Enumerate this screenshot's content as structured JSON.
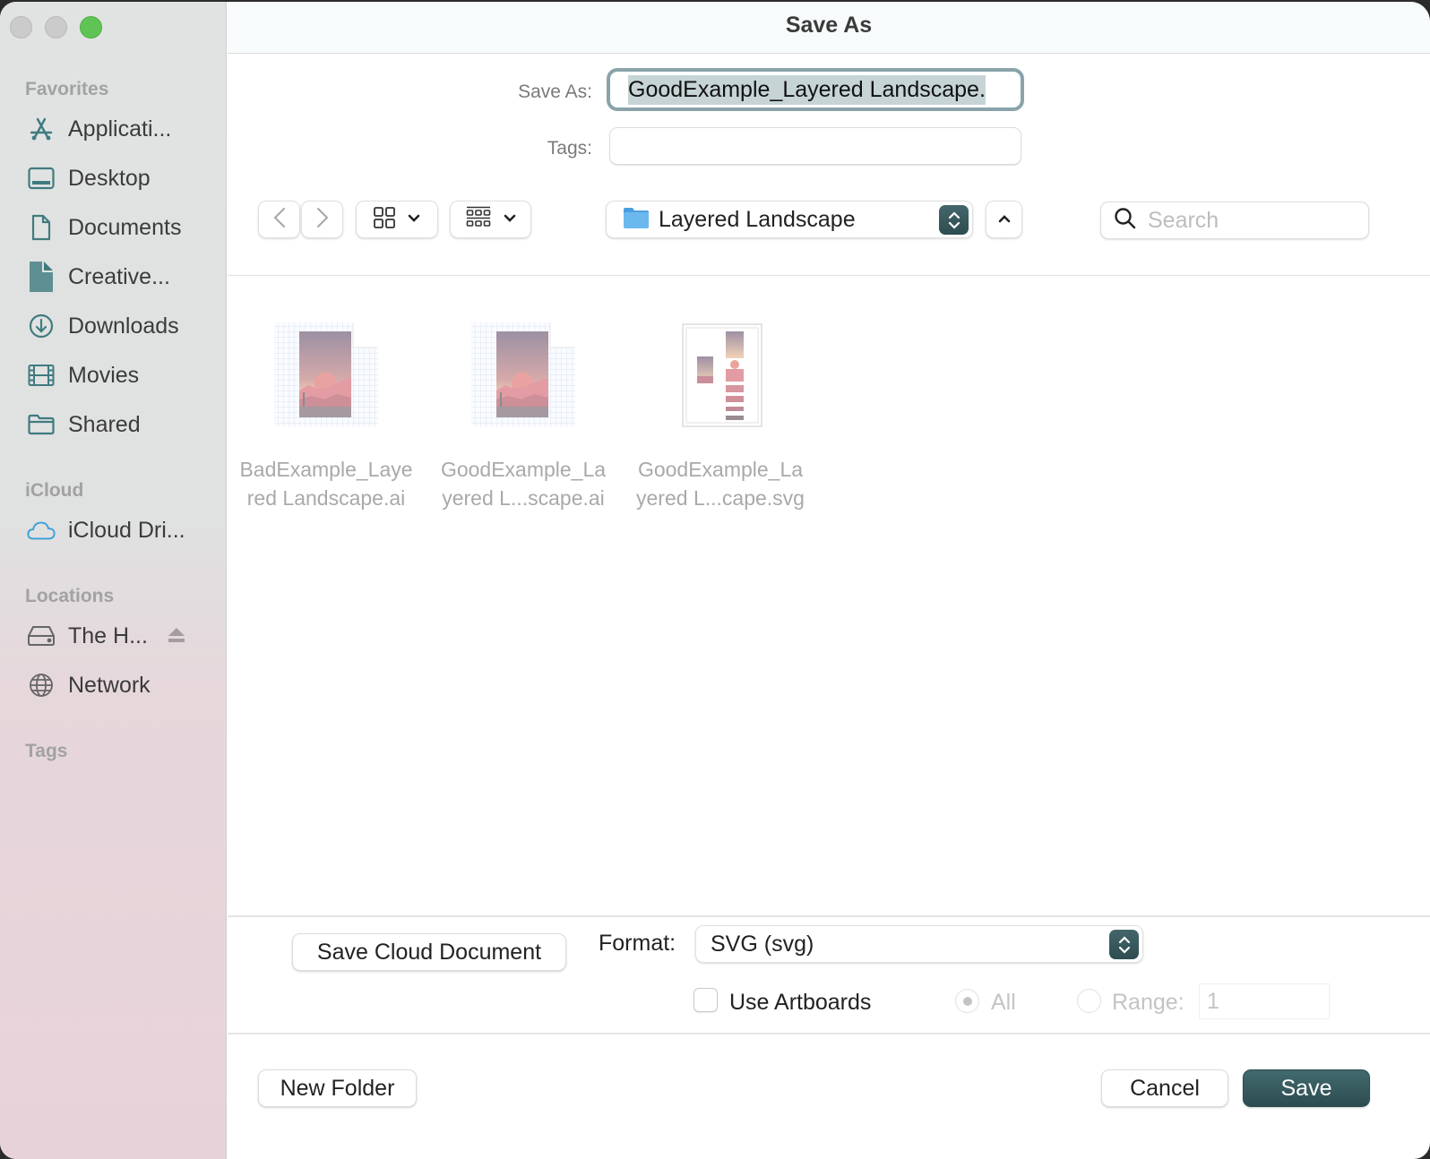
{
  "window": {
    "title": "Save As"
  },
  "sidebar": {
    "sections": [
      {
        "label": "Favorites",
        "items": [
          {
            "label": "Applicati...",
            "icon": "applications-icon"
          },
          {
            "label": "Desktop",
            "icon": "desktop-icon"
          },
          {
            "label": "Documents",
            "icon": "document-icon"
          },
          {
            "label": "Creative...",
            "icon": "creative-cloud-file-icon"
          },
          {
            "label": "Downloads",
            "icon": "downloads-icon"
          },
          {
            "label": "Movies",
            "icon": "film-icon"
          },
          {
            "label": "Shared",
            "icon": "folder-icon"
          }
        ]
      },
      {
        "label": "iCloud",
        "items": [
          {
            "label": "iCloud Dri...",
            "icon": "cloud-icon"
          }
        ]
      },
      {
        "label": "Locations",
        "items": [
          {
            "label": "The H...",
            "icon": "hard-drive-icon",
            "eject": true
          },
          {
            "label": "Network",
            "icon": "globe-icon"
          }
        ]
      },
      {
        "label": "Tags",
        "items": []
      }
    ]
  },
  "form": {
    "save_as_label": "Save As:",
    "save_as_value": "GoodExample_Layered Landscape.",
    "tags_label": "Tags:",
    "tags_value": ""
  },
  "toolbar": {
    "back_icon": "chevron-left-icon",
    "forward_icon": "chevron-right-icon",
    "icon_view": "grid-view-icon",
    "group_view": "gallery-group-icon",
    "location": "Layered Landscape",
    "search_placeholder": "Search"
  },
  "files": [
    {
      "name_line1": "BadExample_Laye",
      "name_line2": "red Landscape.ai",
      "kind": "ai"
    },
    {
      "name_line1": "GoodExample_La",
      "name_line2": "yered L...scape.ai",
      "kind": "ai"
    },
    {
      "name_line1": "GoodExample_La",
      "name_line2": "yered L...cape.svg",
      "kind": "svg"
    }
  ],
  "options": {
    "save_cloud_label": "Save Cloud Document",
    "format_label": "Format:",
    "format_value": "SVG (svg)",
    "use_artboards_label": "Use Artboards",
    "use_artboards_checked": false,
    "all_label": "All",
    "range_label": "Range:",
    "range_value": "1"
  },
  "footer": {
    "new_folder_label": "New Folder",
    "cancel_label": "Cancel",
    "save_label": "Save"
  },
  "colors": {
    "accent": "#2f5256",
    "traffic_max": "#5fc453",
    "icon_tint": "#3f7b7f",
    "cloud_blue": "#3a9fd8"
  }
}
